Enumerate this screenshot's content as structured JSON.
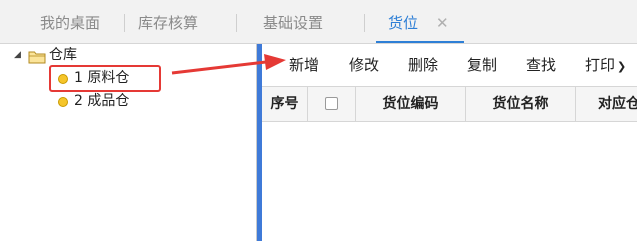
{
  "tabs": [
    {
      "label": "我的桌面"
    },
    {
      "label": "库存核算"
    },
    {
      "label": "基础设置"
    },
    {
      "label": "货位",
      "active": true,
      "close": "✕"
    }
  ],
  "tree": {
    "root": {
      "label": "仓库"
    },
    "children": [
      {
        "label": "1 原料仓",
        "highlighted": true
      },
      {
        "label": "2 成品仓"
      }
    ]
  },
  "toolbar": {
    "add": "新增",
    "edit": "修改",
    "delete": "删除",
    "copy": "复制",
    "find": "查找",
    "print": "打印"
  },
  "grid": {
    "columns": [
      "序号",
      "",
      "货位编码",
      "货位名称",
      "对应仓"
    ]
  },
  "colors": {
    "accent": "#2e7fd6",
    "splitter": "#3f7ad8",
    "annotation": "#e53935",
    "node_dot": "#f5c52a"
  }
}
